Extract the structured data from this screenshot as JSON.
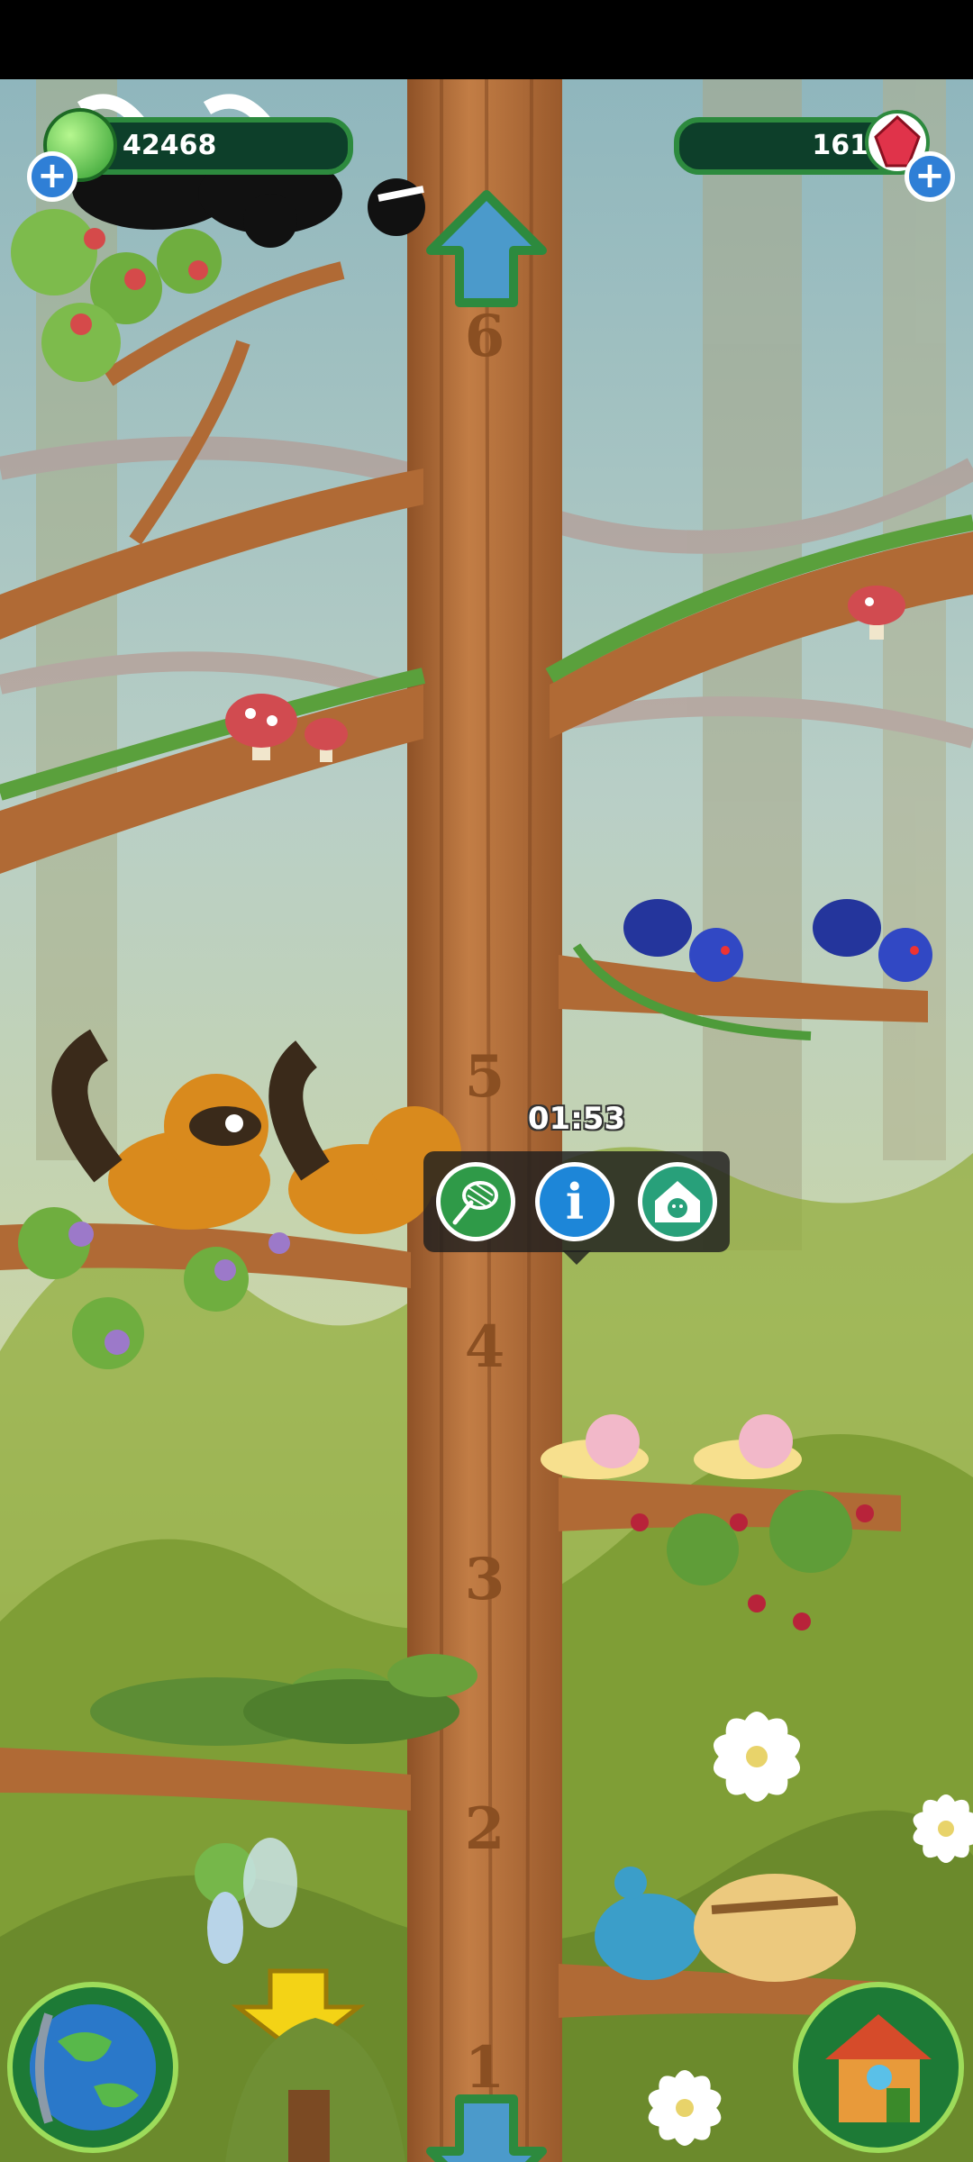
{
  "resources": {
    "gel_count": "42468",
    "gem_count": "161",
    "plus_symbol": "+"
  },
  "tree_levels": [
    "6",
    "5",
    "4",
    "3",
    "2",
    "1"
  ],
  "timer": "01:53",
  "popup_actions": [
    {
      "name": "catch",
      "icon": "net-icon"
    },
    {
      "name": "info",
      "icon": "info-icon",
      "glyph": "i"
    },
    {
      "name": "house",
      "icon": "pet-house-icon"
    }
  ],
  "bottom_bar": {
    "left_icon": "globe-icon",
    "right_icon": "house-icon",
    "up_arrow": "arrow-up-icon",
    "down_arrow": "arrow-down-icon",
    "yellow_arrow": "yellow-down-arrow-icon"
  },
  "colors": {
    "sky": "#a9c7cc",
    "trunk": "#b9733f",
    "leaf": "#6fae3f",
    "resource_bar": "#0d3f2a",
    "popup_bg": "#1e1e1e",
    "accent_green": "#2d8a3e",
    "accent_blue": "#1d86d8"
  }
}
